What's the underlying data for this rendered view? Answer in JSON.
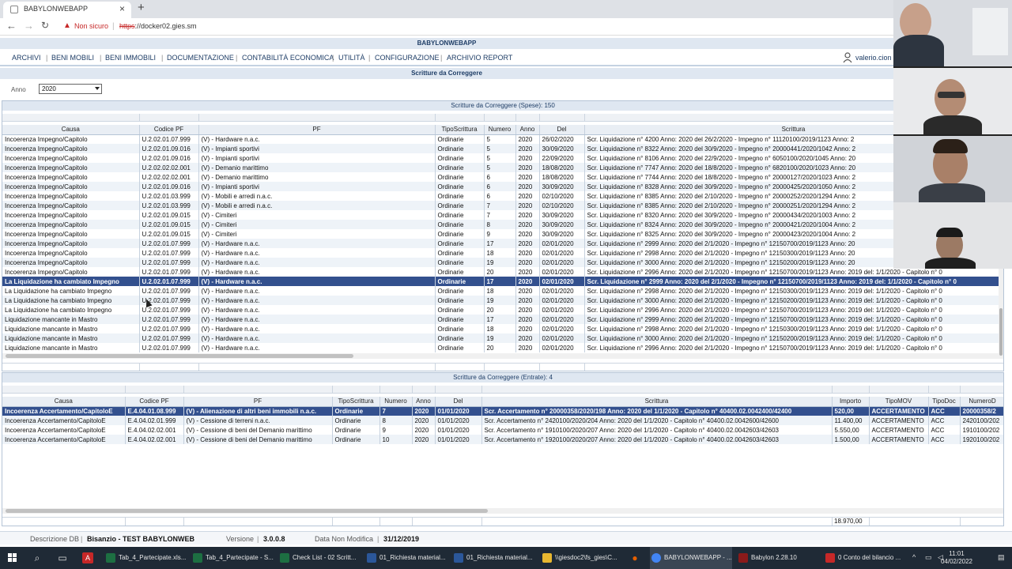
{
  "browser": {
    "tab_title": "BABYLONWEBAPP",
    "not_secure": "Non sicuro",
    "url_scheme": "https",
    "url_rest": "://docker02.gies.sm"
  },
  "app": {
    "title": "BABYLONWEBAPP",
    "user": "valerio.cion"
  },
  "menu": [
    "ARCHIVI",
    "BENI MOBILI",
    "BENI IMMOBILI",
    "DOCUMENTAZIONE",
    "CONTABILITÀ ECONOMICA",
    "UTILITÀ",
    "CONFIGURAZIONE",
    "ARCHIVIO REPORT"
  ],
  "page_title": "Scritture da Correggere",
  "filter": {
    "label": "Anno",
    "value": "2020"
  },
  "spese": {
    "title": "Scritture da Correggere (Spese): 150",
    "columns": [
      "Causa",
      "Codice PF",
      "PF",
      "TipoScrittura",
      "Numero",
      "Anno",
      "Del",
      "Scrittura"
    ],
    "rows": [
      [
        "Incoerenza Impegno/Capitolo",
        "U.2.02.01.07.999",
        "(V) - Hardware n.a.c.",
        "Ordinarie",
        "5",
        "2020",
        "26/02/2020",
        "Scr. Liquidazione n° 4200 Anno: 2020 del 26/2/2020 - Impegno n° 11120100/2019/1123 Anno: 2"
      ],
      [
        "Incoerenza Impegno/Capitolo",
        "U.2.02.01.09.016",
        "(V) - Impianti sportivi",
        "Ordinarie",
        "5",
        "2020",
        "30/09/2020",
        "Scr. Liquidazione n° 8322 Anno: 2020 del 30/9/2020 - Impegno n° 20000441/2020/1042 Anno: 2"
      ],
      [
        "Incoerenza Impegno/Capitolo",
        "U.2.02.01.09.016",
        "(V) - Impianti sportivi",
        "Ordinarie",
        "5",
        "2020",
        "22/09/2020",
        "Scr. Liquidazione n° 8106 Anno: 2020 del 22/9/2020 - Impegno n° 6050100/2020/1045 Anno: 20"
      ],
      [
        "Incoerenza Impegno/Capitolo",
        "U.2.02.02.02.001",
        "(V) - Demanio marittimo",
        "Ordinarie",
        "5",
        "2020",
        "18/08/2020",
        "Scr. Liquidazione n° 7747 Anno: 2020 del 18/8/2020 - Impegno n° 6820100/2020/1023 Anno: 20"
      ],
      [
        "Incoerenza Impegno/Capitolo",
        "U.2.02.02.02.001",
        "(V) - Demanio marittimo",
        "Ordinarie",
        "6",
        "2020",
        "18/08/2020",
        "Scr. Liquidazione n° 7744 Anno: 2020 del 18/8/2020 - Impegno n° 20000127/2020/1023 Anno: 2"
      ],
      [
        "Incoerenza Impegno/Capitolo",
        "U.2.02.01.09.016",
        "(V) - Impianti sportivi",
        "Ordinarie",
        "6",
        "2020",
        "30/09/2020",
        "Scr. Liquidazione n° 8328 Anno: 2020 del 30/9/2020 - Impegno n° 20000425/2020/1050 Anno: 2"
      ],
      [
        "Incoerenza Impegno/Capitolo",
        "U.2.02.01.03.999",
        "(V) - Mobili e arredi n.a.c.",
        "Ordinarie",
        "6",
        "2020",
        "02/10/2020",
        "Scr. Liquidazione n° 8385 Anno: 2020 del 2/10/2020 - Impegno n° 20000252/2020/1294 Anno: 2"
      ],
      [
        "Incoerenza Impegno/Capitolo",
        "U.2.02.01.03.999",
        "(V) - Mobili e arredi n.a.c.",
        "Ordinarie",
        "7",
        "2020",
        "02/10/2020",
        "Scr. Liquidazione n° 8385 Anno: 2020 del 2/10/2020 - Impegno n° 20000251/2020/1294 Anno: 2"
      ],
      [
        "Incoerenza Impegno/Capitolo",
        "U.2.02.01.09.015",
        "(V) - Cimiteri",
        "Ordinarie",
        "7",
        "2020",
        "30/09/2020",
        "Scr. Liquidazione n° 8320 Anno: 2020 del 30/9/2020 - Impegno n° 20000434/2020/1003 Anno: 2"
      ],
      [
        "Incoerenza Impegno/Capitolo",
        "U.2.02.01.09.015",
        "(V) - Cimiteri",
        "Ordinarie",
        "8",
        "2020",
        "30/09/2020",
        "Scr. Liquidazione n° 8324 Anno: 2020 del 30/9/2020 - Impegno n° 20000421/2020/1004 Anno: 2"
      ],
      [
        "Incoerenza Impegno/Capitolo",
        "U.2.02.01.09.015",
        "(V) - Cimiteri",
        "Ordinarie",
        "9",
        "2020",
        "30/09/2020",
        "Scr. Liquidazione n° 8325 Anno: 2020 del 30/9/2020 - Impegno n° 20000423/2020/1004 Anno: 2"
      ],
      [
        "Incoerenza Impegno/Capitolo",
        "U.2.02.01.07.999",
        "(V) - Hardware n.a.c.",
        "Ordinarie",
        "17",
        "2020",
        "02/01/2020",
        "Scr. Liquidazione n° 2999 Anno: 2020 del 2/1/2020 - Impegno n° 12150700/2019/1123 Anno: 20"
      ],
      [
        "Incoerenza Impegno/Capitolo",
        "U.2.02.01.07.999",
        "(V) - Hardware n.a.c.",
        "Ordinarie",
        "18",
        "2020",
        "02/01/2020",
        "Scr. Liquidazione n° 2998 Anno: 2020 del 2/1/2020 - Impegno n° 12150300/2019/1123 Anno: 20"
      ],
      [
        "Incoerenza Impegno/Capitolo",
        "U.2.02.01.07.999",
        "(V) - Hardware n.a.c.",
        "Ordinarie",
        "19",
        "2020",
        "02/01/2020",
        "Scr. Liquidazione n° 3000 Anno: 2020 del 2/1/2020 - Impegno n° 12150200/2019/1123 Anno: 20"
      ],
      [
        "Incoerenza Impegno/Capitolo",
        "U.2.02.01.07.999",
        "(V) - Hardware n.a.c.",
        "Ordinarie",
        "20",
        "2020",
        "02/01/2020",
        "Scr. Liquidazione n° 2996 Anno: 2020 del 2/1/2020 - Impegno n° 12150700/2019/1123 Anno: 2019 del: 1/1/2020 - Capitolo n° 0"
      ],
      [
        "La Liquidazione ha cambiato Impegno",
        "U.2.02.01.07.999",
        "(V) - Hardware n.a.c.",
        "Ordinarie",
        "17",
        "2020",
        "02/01/2020",
        "Scr. Liquidazione n° 2999 Anno: 2020 del 2/1/2020 - Impegno n° 12150700/2019/1123 Anno: 2019 del: 1/1/2020 - Capitolo n° 0"
      ],
      [
        "La Liquidazione ha cambiato Impegno",
        "U.2.02.01.07.999",
        "(V) - Hardware n.a.c.",
        "Ordinarie",
        "18",
        "2020",
        "02/01/2020",
        "Scr. Liquidazione n° 2998 Anno: 2020 del 2/1/2020 - Impegno n° 12150300/2019/1123 Anno: 2019 del: 1/1/2020 - Capitolo n° 0"
      ],
      [
        "La Liquidazione ha cambiato Impegno",
        "U.2.02.01.07.999",
        "(V) - Hardware n.a.c.",
        "Ordinarie",
        "19",
        "2020",
        "02/01/2020",
        "Scr. Liquidazione n° 3000 Anno: 2020 del 2/1/2020 - Impegno n° 12150200/2019/1123 Anno: 2019 del: 1/1/2020 - Capitolo n° 0"
      ],
      [
        "La Liquidazione ha cambiato Impegno",
        "U.2.02.01.07.999",
        "(V) - Hardware n.a.c.",
        "Ordinarie",
        "20",
        "2020",
        "02/01/2020",
        "Scr. Liquidazione n° 2996 Anno: 2020 del 2/1/2020 - Impegno n° 12150700/2019/1123 Anno: 2019 del: 1/1/2020 - Capitolo n° 0"
      ],
      [
        "Liquidazione mancante in Mastro",
        "U.2.02.01.07.999",
        "(V) - Hardware n.a.c.",
        "Ordinarie",
        "17",
        "2020",
        "02/01/2020",
        "Scr. Liquidazione n° 2999 Anno: 2020 del 2/1/2020 - Impegno n° 12150700/2019/1123 Anno: 2019 del: 1/1/2020 - Capitolo n° 0"
      ],
      [
        "Liquidazione mancante in Mastro",
        "U.2.02.01.07.999",
        "(V) - Hardware n.a.c.",
        "Ordinarie",
        "18",
        "2020",
        "02/01/2020",
        "Scr. Liquidazione n° 2998 Anno: 2020 del 2/1/2020 - Impegno n° 12150300/2019/1123 Anno: 2019 del: 1/1/2020 - Capitolo n° 0"
      ],
      [
        "Liquidazione mancante in Mastro",
        "U.2.02.01.07.999",
        "(V) - Hardware n.a.c.",
        "Ordinarie",
        "19",
        "2020",
        "02/01/2020",
        "Scr. Liquidazione n° 3000 Anno: 2020 del 2/1/2020 - Impegno n° 12150200/2019/1123 Anno: 2019 del: 1/1/2020 - Capitolo n° 0"
      ],
      [
        "Liquidazione mancante in Mastro",
        "U.2.02.01.07.999",
        "(V) - Hardware n.a.c.",
        "Ordinarie",
        "20",
        "2020",
        "02/01/2020",
        "Scr. Liquidazione n° 2996 Anno: 2020 del 2/1/2020 - Impegno n° 12150700/2019/1123 Anno: 2019 del: 1/1/2020 - Capitolo n° 0"
      ]
    ],
    "selected_row": 15
  },
  "entrate": {
    "title": "Scritture da Correggere (Entrate): 4",
    "columns": [
      "Causa",
      "Codice PF",
      "PF",
      "TipoScrittura",
      "Numero",
      "Anno",
      "Del",
      "Scrittura",
      "Importo",
      "TipoMOV",
      "TipoDoc",
      "NumeroD"
    ],
    "rows": [
      [
        "Incoerenza Accertamento/CapitoloE",
        "E.4.04.01.08.999",
        "(V) - Alienazione di altri beni immobili n.a.c.",
        "Ordinarie",
        "7",
        "2020",
        "01/01/2020",
        "Scr. Accertamento n° 20000358/2020/198 Anno: 2020 del 1/1/2020 - Capitolo n° 40400.02.0042400/42400",
        "520,00",
        "ACCERTAMENTO",
        "ACC",
        "20000358/2"
      ],
      [
        "Incoerenza Accertamento/CapitoloE",
        "E.4.04.02.01.999",
        "(V) - Cessione di terreni n.a.c.",
        "Ordinarie",
        "8",
        "2020",
        "01/01/2020",
        "Scr. Accertamento n° 2420100/2020/204 Anno: 2020 del 1/1/2020 - Capitolo n° 40400.02.0042600/42600",
        "11.400,00",
        "ACCERTAMENTO",
        "ACC",
        "2420100/202"
      ],
      [
        "Incoerenza Accertamento/CapitoloE",
        "E.4.04.02.02.001",
        "(V) - Cessione di beni del Demanio marittimo",
        "Ordinarie",
        "9",
        "2020",
        "01/01/2020",
        "Scr. Accertamento n° 1910100/2020/207 Anno: 2020 del 1/1/2020 - Capitolo n° 40400.02.0042603/42603",
        "5.550,00",
        "ACCERTAMENTO",
        "ACC",
        "1910100/202"
      ],
      [
        "Incoerenza Accertamento/CapitoloE",
        "E.4.04.02.02.001",
        "(V) - Cessione di beni del Demanio marittimo",
        "Ordinarie",
        "10",
        "2020",
        "01/01/2020",
        "Scr. Accertamento n° 1920100/2020/207 Anno: 2020 del 1/1/2020 - Capitolo n° 40400.02.0042603/42603",
        "1.500,00",
        "ACCERTAMENTO",
        "ACC",
        "1920100/202"
      ]
    ],
    "selected_row": 0,
    "total": "18.970,00"
  },
  "status": {
    "desc_label": "Descrizione DB",
    "desc_value": "Bisanzio - TEST BABYLONWEB",
    "ver_label": "Versione",
    "ver_value": "3.0.0.8",
    "date_label": "Data Non Modifica",
    "date_value": "31/12/2019"
  },
  "taskbar": {
    "items": [
      "Tab_4_Partecipate.xls...",
      "Tab_4_Partecipate - S...",
      "Check List - 02 Scritt...",
      "01_Richiesta material...",
      "01_Richiesta material...",
      "\\\\giesdoc2\\fs_gies\\C...",
      "BABYLONWEBAPP - ...",
      "Babylon 2.28.10",
      "0 Conto del bilancio ..."
    ],
    "time": "11:01",
    "date": "04/02/2022"
  }
}
